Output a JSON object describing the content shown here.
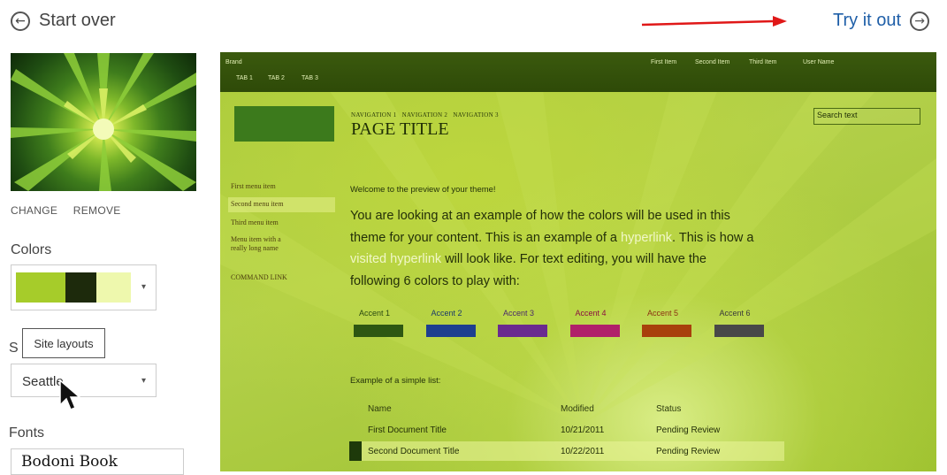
{
  "header": {
    "start_over": "Start over",
    "try_it_out": "Try it out"
  },
  "left_panel": {
    "image_actions": {
      "change": "CHANGE",
      "remove": "REMOVE"
    },
    "colors": {
      "label": "Colors",
      "swatches": [
        "#a6cc2a",
        "#1d2a0c",
        "#eef8ad"
      ]
    },
    "site_layouts": {
      "label_visible_part": "S",
      "tooltip": "Site layouts",
      "value": "Seattle"
    },
    "fonts": {
      "label": "Fonts",
      "value": "Bodoni Book"
    }
  },
  "preview": {
    "suite_bar": {
      "brand": "Brand",
      "tabs": [
        "TAB 1",
        "TAB 2",
        "TAB 3"
      ],
      "links": [
        "First Item",
        "Second Item",
        "Third Item"
      ],
      "user": "User Name"
    },
    "navigation": [
      "NAVIGATION 1",
      "NAVIGATION 2",
      "NAVIGATION 3"
    ],
    "page_title": "PAGE TITLE",
    "search_placeholder": "Search text",
    "menu": {
      "items": [
        "First menu item",
        "Second menu item",
        "Third menu item",
        "Menu item with a",
        "really long name"
      ],
      "command": "COMMAND LINK"
    },
    "welcome": "Welcome to the preview of your theme!",
    "body": {
      "line1": "You are looking at an example of how the colors will be used in this",
      "line2a": "theme for your content. This is an example of a ",
      "hyperlink": "hyperlink",
      "line2b": ". This is how a",
      "visited": "visited hyperlink",
      "line3": " will look like. For text editing, you will have the",
      "line4": "following 6 colors to play with:"
    },
    "accents": [
      {
        "label": "Accent 1",
        "label_color": "#2a4a10",
        "color": "#2e5712"
      },
      {
        "label": "Accent 2",
        "label_color": "#1b3a6a",
        "color": "#1d3f8f"
      },
      {
        "label": "Accent 3",
        "label_color": "#4a2a6a",
        "color": "#6a2a8f"
      },
      {
        "label": "Accent 4",
        "label_color": "#8a1040",
        "color": "#b0206a"
      },
      {
        "label": "Accent 5",
        "label_color": "#8a3010",
        "color": "#a8400c"
      },
      {
        "label": "Accent 6",
        "label_color": "#3a3a3a",
        "color": "#484848"
      }
    ],
    "list": {
      "label": "Example of a simple list:",
      "headers": [
        "Name",
        "Modified",
        "Status"
      ],
      "rows": [
        [
          "First Document Title",
          "10/21/2011",
          "Pending Review"
        ],
        [
          "Second Document Title",
          "10/22/2011",
          "Pending Review"
        ]
      ]
    }
  }
}
